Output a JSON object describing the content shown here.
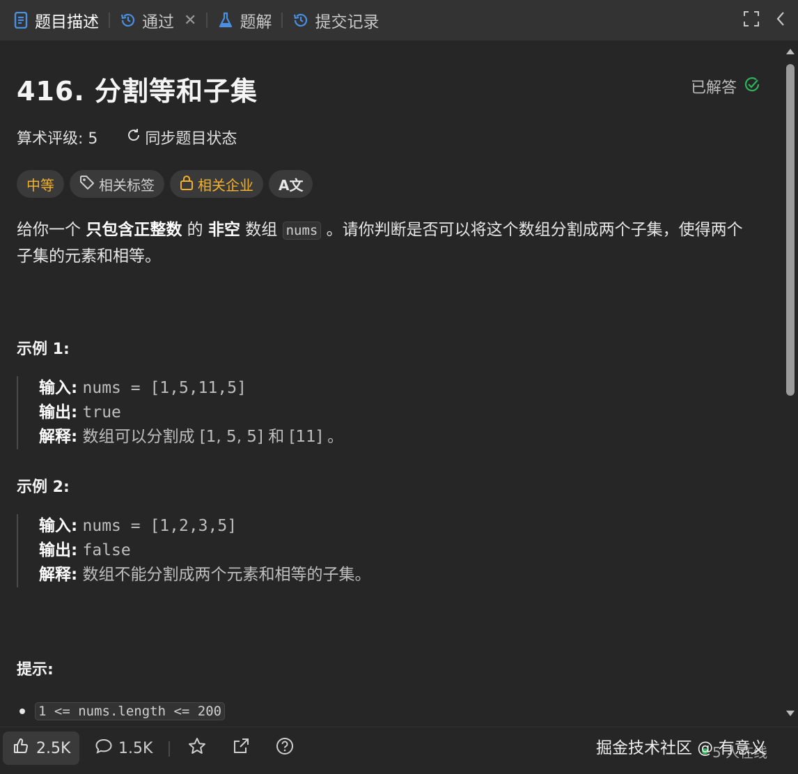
{
  "tabs": [
    {
      "label": "题目描述",
      "icon": "doc-icon",
      "active": true
    },
    {
      "label": "通过",
      "icon": "history-icon",
      "closable": true
    },
    {
      "label": "题解",
      "icon": "flask-icon"
    },
    {
      "label": "提交记录",
      "icon": "history-icon"
    }
  ],
  "problem": {
    "title": "416. 分割等和子集",
    "status": "已解答",
    "rating": "算术评级: 5",
    "sync_label": "同步题目状态",
    "tags": {
      "difficulty": "中等",
      "related_tags": "相关标签",
      "related_companies": "相关企业",
      "translate": "A文"
    },
    "description": {
      "p1_a": "给你一个 ",
      "p1_b": "只包含正整数",
      "p1_c": " 的 ",
      "p1_d": "非空",
      "p1_e": " 数组 ",
      "p1_code": "nums",
      "p1_f": " 。请你判断是否可以将这个数组分割成两个子集，使得两个子集的元素和相等。"
    }
  },
  "examples": [
    {
      "heading": "示例 1:",
      "input_label": "输入:",
      "input": "nums = [1,5,11,5]",
      "output_label": "输出:",
      "output": "true",
      "explain_label": "解释:",
      "explain": "数组可以分割成 [1, 5, 5] 和 [11] 。"
    },
    {
      "heading": "示例 2:",
      "input_label": "输入:",
      "input": "nums = [1,2,3,5]",
      "output_label": "输出:",
      "output": "false",
      "explain_label": "解释:",
      "explain": "数组不能分割成两个元素和相等的子集。"
    }
  ],
  "hints": {
    "heading": "提示:",
    "items": [
      "1 <= nums.length <= 200"
    ]
  },
  "bottom": {
    "likes": "2.5K",
    "comments": "1.5K",
    "watermark": "掘金技术社区 @ 有意义",
    "online": "5 人在线"
  },
  "colors": {
    "accent_blue": "#4a90e2",
    "difficulty": "#f2b12a",
    "solved_green": "#2db55d",
    "background": "#262626",
    "tabbar": "#333333"
  }
}
